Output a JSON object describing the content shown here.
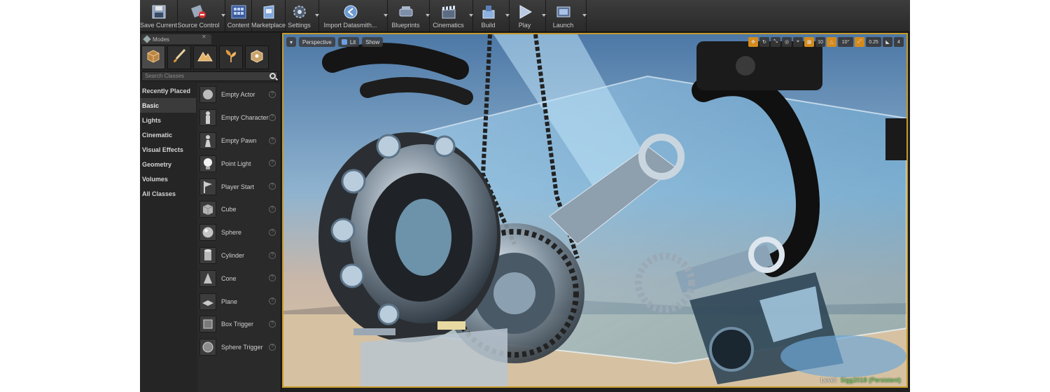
{
  "toolbar": {
    "buttons": [
      {
        "label": "Save Current",
        "icon": "save-icon"
      },
      {
        "label": "Source Control",
        "icon": "source-control-icon"
      },
      {
        "label": "Content",
        "icon": "content-icon"
      },
      {
        "label": "Marketplace",
        "icon": "marketplace-icon"
      },
      {
        "label": "Settings",
        "icon": "settings-icon"
      },
      {
        "label": "Import Datasmith...",
        "icon": "datasmith-icon"
      },
      {
        "label": "Blueprints",
        "icon": "blueprints-icon"
      },
      {
        "label": "Cinematics",
        "icon": "cinematics-icon"
      },
      {
        "label": "Build",
        "icon": "build-icon"
      },
      {
        "label": "Play",
        "icon": "play-icon"
      },
      {
        "label": "Launch",
        "icon": "launch-icon"
      }
    ]
  },
  "modes": {
    "tab_label": "Modes",
    "search_placeholder": "Search Classes",
    "categories": [
      "Recently Placed",
      "Basic",
      "Lights",
      "Cinematic",
      "Visual Effects",
      "Geometry",
      "Volumes",
      "All Classes"
    ],
    "selected_category": "Basic",
    "items": [
      "Empty Actor",
      "Empty Character",
      "Empty Pawn",
      "Point Light",
      "Player Start",
      "Cube",
      "Sphere",
      "Cylinder",
      "Cone",
      "Plane",
      "Box Trigger",
      "Sphere Trigger"
    ]
  },
  "viewport": {
    "view_mode": "Perspective",
    "lighting": "Lit",
    "show": "Show",
    "grid_snap": "10",
    "rotation_snap": "10°",
    "scale_snap": "0.25",
    "camera_speed": "4",
    "level_label": "Level:",
    "level_name": "Sigg2018 (Persistent)"
  },
  "colors": {
    "editor_bg": "#252525",
    "viewport_border": "#c79a2b",
    "active_tool": "#d48a1c",
    "level_name": "#5fd15f"
  }
}
